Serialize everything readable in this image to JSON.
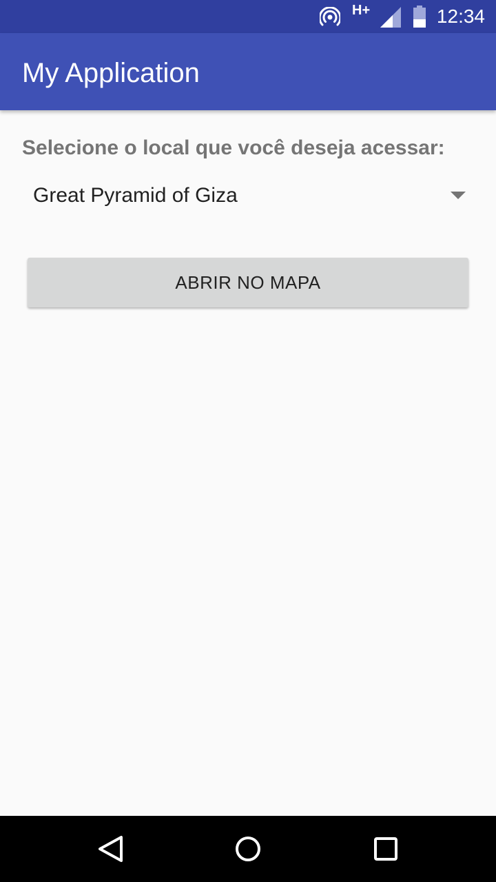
{
  "status_bar": {
    "network_type": "H+",
    "time": "12:34",
    "icons": [
      "hotspot-icon",
      "signal-icon",
      "battery-icon"
    ]
  },
  "app_bar": {
    "title": "My Application",
    "color": "#3f51b5",
    "status_color": "#303f9f"
  },
  "content": {
    "prompt": "Selecione o local que você deseja acessar:",
    "spinner": {
      "selected": "Great Pyramid of Giza"
    },
    "open_map_button": {
      "label": "ABRIR NO MAPA"
    }
  },
  "nav_bar": {
    "buttons": [
      "back-icon",
      "home-icon",
      "recents-icon"
    ]
  }
}
